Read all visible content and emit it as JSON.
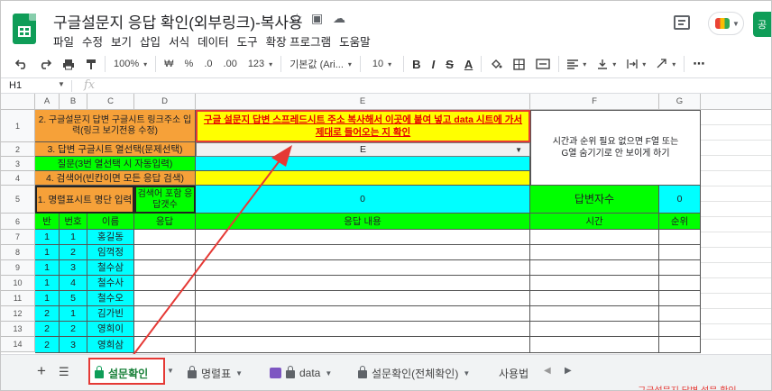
{
  "doc": {
    "title": "구글설문지 응답 확인(외부링크)-복사용",
    "menu": [
      "파일",
      "수정",
      "보기",
      "삽입",
      "서식",
      "데이터",
      "도구",
      "확장 프로그램",
      "도움말"
    ],
    "share_label": "공"
  },
  "toolbar": {
    "zoom": "100%",
    "currency": "₩",
    "percent": "%",
    "dec_less": ".0",
    "dec_more": ".00",
    "format": "123",
    "font": "기본값 (Ari...",
    "size": "10",
    "bold": "B",
    "italic": "I",
    "strike": "S",
    "text_color": "A",
    "more": "⋯"
  },
  "formula": {
    "namebox": "H1",
    "fx": "fx"
  },
  "columns": [
    "A",
    "B",
    "C",
    "D",
    "E",
    "F",
    "G"
  ],
  "rows": [
    "1",
    "2",
    "3",
    "4",
    "5",
    "6",
    "7",
    "8",
    "9",
    "10",
    "11",
    "12",
    "13",
    "14"
  ],
  "sheet": {
    "r1_label": "2. 구글설문지 답변 구글시트 링크주소 입력(링크 보기전용 수정)",
    "r1_e": "구글 설문지 답변 스프레드시트 주소 복사해서 이곳에 붙여 넣고 data 시트에 가서 제대로 들어오는 지 확인",
    "f_note": "시간과 순위 필요 없으면 F열 또는 G열 숨기기로 안 보이게 하기",
    "r2_label": "3. 답변 구글시트 열선택(문제선택)",
    "r2_value": "E",
    "r3_label": "질문(3번 열선택 시 자동입력)",
    "r4_label": "4. 검색어(빈칸이면 모든 응답 검색)",
    "r5_label": "1. 명렬표시트 명단 입력",
    "r5_d": "검색어 포함 응답갯수",
    "r5_e": "0",
    "r5_f": "답변자수",
    "r5_g": "0",
    "headers": [
      "반",
      "번호",
      "이름",
      "응답",
      "응답 내용",
      "시간",
      "순위"
    ],
    "students": [
      {
        "ban": "1",
        "num": "1",
        "name": "홍길동"
      },
      {
        "ban": "1",
        "num": "2",
        "name": "임꺽정"
      },
      {
        "ban": "1",
        "num": "3",
        "name": "철수삼"
      },
      {
        "ban": "1",
        "num": "4",
        "name": "철수사"
      },
      {
        "ban": "1",
        "num": "5",
        "name": "철수오"
      },
      {
        "ban": "2",
        "num": "1",
        "name": "김가빈"
      },
      {
        "ban": "2",
        "num": "2",
        "name": "영희이"
      },
      {
        "ban": "2",
        "num": "3",
        "name": "영희삼"
      }
    ]
  },
  "tabs": [
    {
      "label": "설문확인"
    },
    {
      "label": "명렬표"
    },
    {
      "label": "data"
    },
    {
      "label": "설문확인(전체확인)"
    },
    {
      "label": "사용법"
    }
  ],
  "footer": {
    "clipped_text": "구글설문지 답변 설문 확인"
  },
  "colors": {
    "orange": "#f6a139",
    "yellow": "#ffff00",
    "cyan": "#00ffff",
    "green": "#00ff00",
    "annotation_red": "#e53935"
  }
}
